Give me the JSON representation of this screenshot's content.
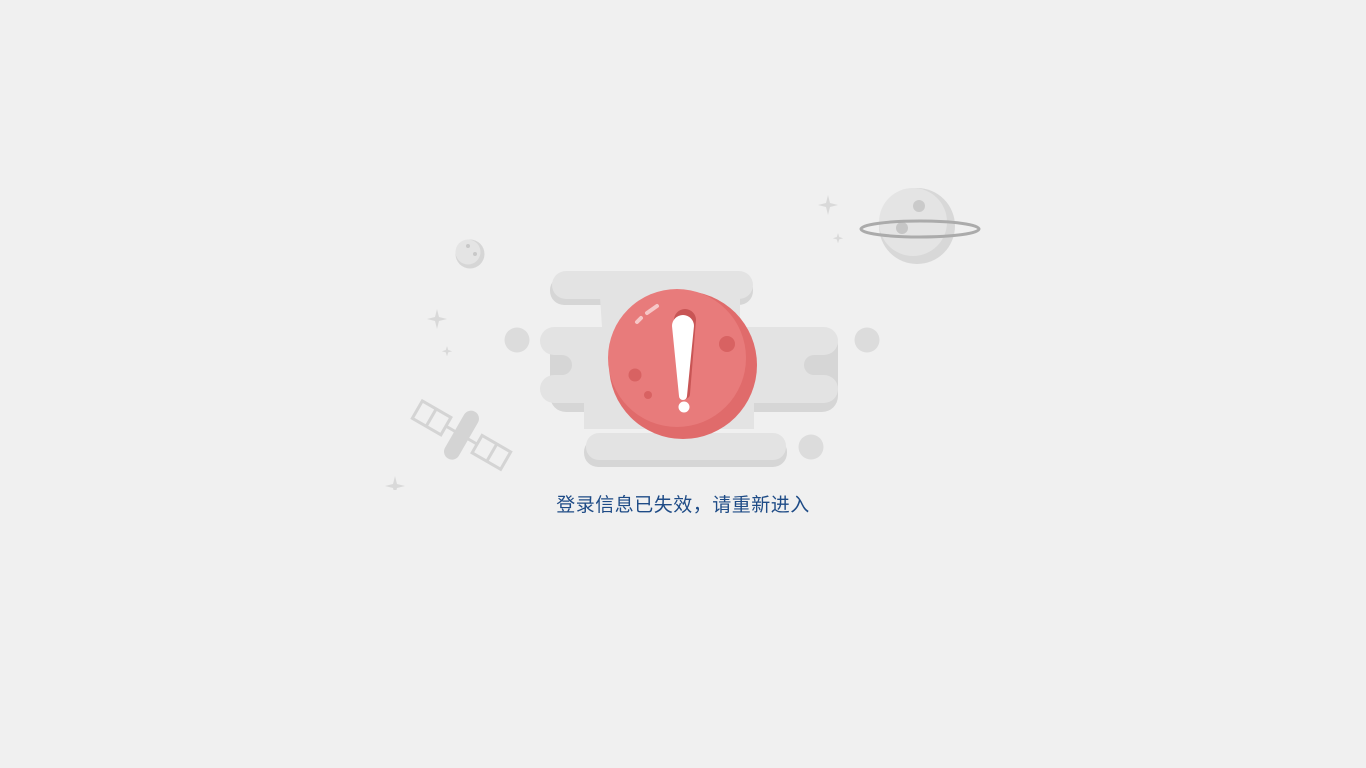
{
  "message": {
    "text": "登录信息已失效，请重新进入"
  },
  "illustration": {
    "alert_symbol": "!",
    "icons": [
      "alert-planet-icon",
      "cloud-shape",
      "ringed-planet-icon",
      "small-moon-icon",
      "satellite-icon",
      "sparkle-icon"
    ]
  },
  "colors": {
    "background": "#f0f0f0",
    "message_text": "#1e4b86",
    "alert_planet": "#e87b7b",
    "cloud": "#e2e2e2"
  }
}
